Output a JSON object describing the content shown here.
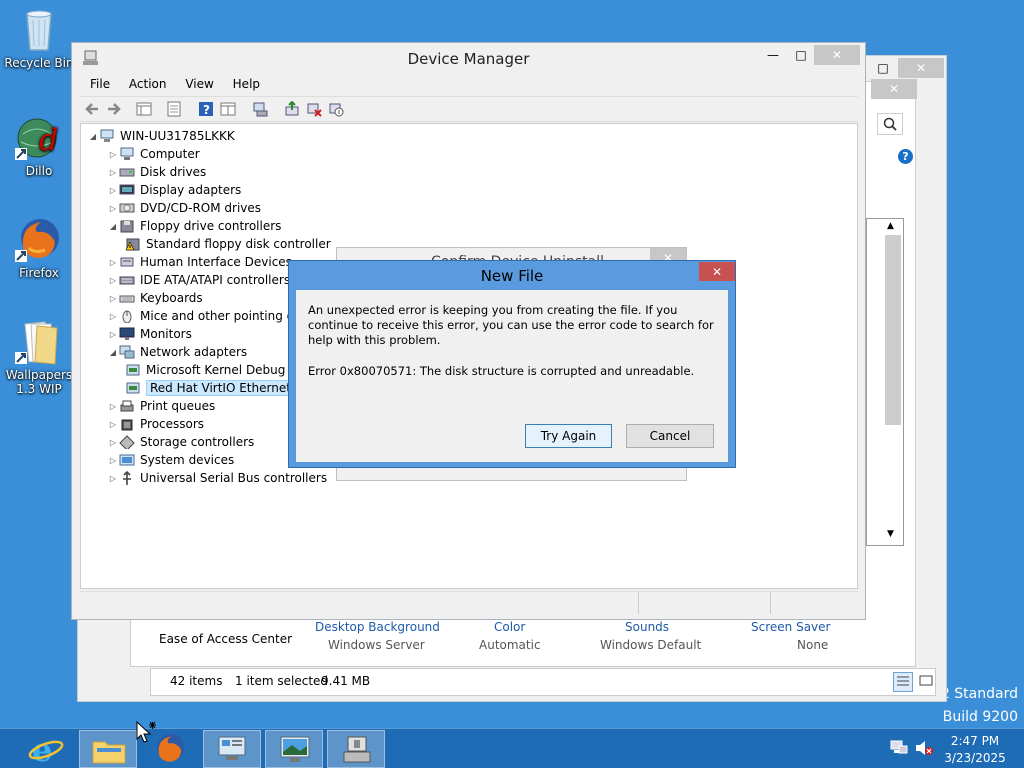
{
  "desktop": {
    "icons": [
      {
        "label": "Recycle Bin",
        "icon": "recycle-bin-icon"
      },
      {
        "label": "Dillo",
        "icon": "dillo-icon"
      },
      {
        "label": "Firefox",
        "icon": "firefox-icon"
      },
      {
        "label_line1": "Wallpapers",
        "label_line2": "1.3 WIP",
        "icon": "folder-icon"
      }
    ],
    "watermark_line1": "2 Standard",
    "watermark_line2": "Build 9200"
  },
  "background_window": {
    "links": [
      {
        "title": "Desktop Background",
        "value": "Windows Server"
      },
      {
        "title": "Color",
        "value": "Automatic"
      },
      {
        "title": "Sounds",
        "value": "Windows Default"
      },
      {
        "title": "Screen Saver",
        "value": "None"
      }
    ],
    "ease_of_access": "Ease of Access Center"
  },
  "explorer_status": {
    "items": "42 items",
    "selected": "1 item selected",
    "size": "9.41 MB"
  },
  "device_manager": {
    "title": "Device Manager",
    "menu": [
      "File",
      "Action",
      "View",
      "Help"
    ],
    "computer_name": "WIN-UU31785LKKK",
    "tree": [
      {
        "label": "Computer",
        "expanded": false,
        "icon": "computer-icon"
      },
      {
        "label": "Disk drives",
        "expanded": false,
        "icon": "disk-drive-icon"
      },
      {
        "label": "Display adapters",
        "expanded": false,
        "icon": "display-adapter-icon"
      },
      {
        "label": "DVD/CD-ROM drives",
        "expanded": false,
        "icon": "dvd-drive-icon"
      },
      {
        "label": "Floppy drive controllers",
        "expanded": true,
        "icon": "floppy-controller-icon"
      },
      {
        "label": "Standard floppy disk controller",
        "child": true,
        "icon": "floppy-warning-icon"
      },
      {
        "label": "Human Interface Devices",
        "expanded": false,
        "icon": "hid-icon"
      },
      {
        "label": "IDE ATA/ATAPI controllers",
        "expanded": false,
        "icon": "ide-controller-icon"
      },
      {
        "label": "Keyboards",
        "expanded": false,
        "icon": "keyboard-icon"
      },
      {
        "label": "Mice and other pointing de",
        "expanded": false,
        "icon": "mouse-icon"
      },
      {
        "label": "Monitors",
        "expanded": false,
        "icon": "monitor-icon"
      },
      {
        "label": "Network adapters",
        "expanded": true,
        "icon": "network-adapter-icon"
      },
      {
        "label": "Microsoft Kernel Debug",
        "child": true,
        "icon": "network-card-icon"
      },
      {
        "label": "Red Hat VirtIO Ethernet",
        "child": true,
        "selected": true,
        "icon": "network-card-icon"
      },
      {
        "label": "Print queues",
        "expanded": false,
        "icon": "printer-icon"
      },
      {
        "label": "Processors",
        "expanded": false,
        "icon": "processor-icon"
      },
      {
        "label": "Storage controllers",
        "expanded": false,
        "icon": "storage-controller-icon"
      },
      {
        "label": "System devices",
        "expanded": false,
        "icon": "system-device-icon"
      },
      {
        "label": "Universal Serial Bus controllers",
        "expanded": false,
        "icon": "usb-icon"
      }
    ]
  },
  "confirm_dialog": {
    "title": "Confirm Device Uninstall"
  },
  "new_file_dialog": {
    "title": "New File",
    "message": "An unexpected error is keeping you from creating the file. If you continue to receive this error, you can use the error code to search for help with this problem.",
    "error": "Error 0x80070571: The disk structure is corrupted and unreadable.",
    "try_again": "Try Again",
    "cancel": "Cancel"
  },
  "taskbar": {
    "time": "2:47 PM",
    "date": "3/23/2025"
  },
  "colors": {
    "desktop": "#3a8fd8",
    "taskbar": "#1f6cb6",
    "dialog_border": "#5a9be0",
    "selection": "#cce8ff",
    "close_red": "#c75050"
  }
}
